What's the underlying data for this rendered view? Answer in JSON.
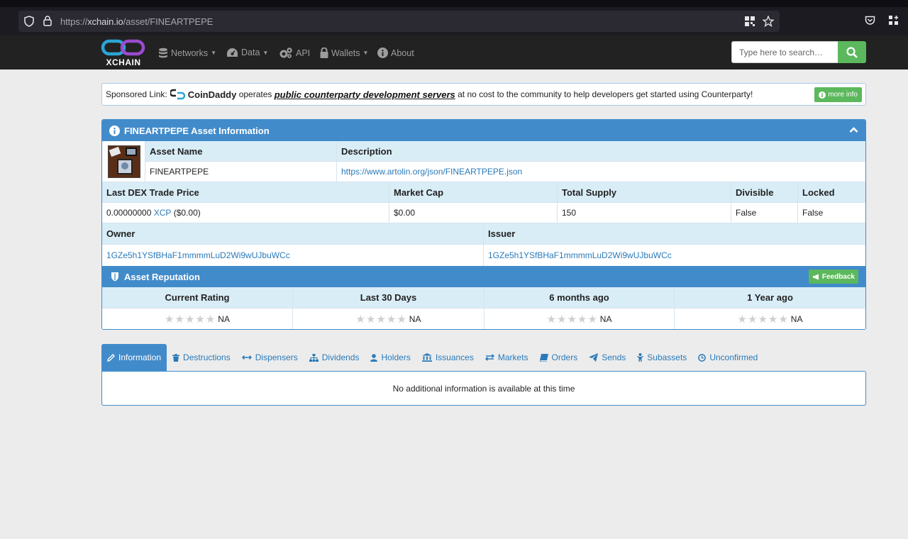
{
  "browser": {
    "url_prefix": "https://",
    "url_host": "xchain.io",
    "url_path": "/asset/FINEARTPEPE"
  },
  "navbar": {
    "logo_text": "XCHAIN",
    "items": [
      {
        "label": "Networks",
        "icon": "database-icon",
        "dropdown": true
      },
      {
        "label": "Data",
        "icon": "dashboard-icon",
        "dropdown": true
      },
      {
        "label": "API",
        "icon": "gears-icon",
        "dropdown": false
      },
      {
        "label": "Wallets",
        "icon": "lock-icon",
        "dropdown": true
      },
      {
        "label": "About",
        "icon": "info-circle-icon",
        "dropdown": false
      }
    ],
    "search_placeholder": "Type here to search…"
  },
  "sponsor": {
    "prefix": "Sponsored Link:",
    "brand": "CoinDaddy",
    "mid": " operates ",
    "link": "public counterparty development servers",
    "suffix": " at no cost to the community to help developers get started using Counterparty!",
    "button": "more info"
  },
  "asset_panel": {
    "title": "FINEARTPEPE Asset Information",
    "asset_name_label": "Asset Name",
    "asset_name": "FINEARTPEPE",
    "description_label": "Description",
    "description": "https://www.artolin.org/json/FINEARTPEPE.json",
    "last_trade_label": "Last DEX Trade Price",
    "last_trade_amount": "0.00000000 ",
    "last_trade_currency": "XCP",
    "last_trade_usd": " ($0.00)",
    "market_cap_label": "Market Cap",
    "market_cap": "$0.00",
    "total_supply_label": "Total Supply",
    "total_supply": "150",
    "divisible_label": "Divisible",
    "divisible": "False",
    "locked_label": "Locked",
    "locked": "False",
    "owner_label": "Owner",
    "owner": "1GZe5h1YSfBHaF1mmmmLuD2Wi9wUJbuWCc",
    "issuer_label": "Issuer",
    "issuer": "1GZe5h1YSfBHaF1mmmmLuD2Wi9wUJbuWCc"
  },
  "reputation": {
    "title": "Asset Reputation",
    "feedback_button": "Feedback",
    "columns": [
      {
        "label": "Current Rating",
        "value": "NA"
      },
      {
        "label": "Last 30 Days",
        "value": "NA"
      },
      {
        "label": "6 months ago",
        "value": "NA"
      },
      {
        "label": "1 Year ago",
        "value": "NA"
      }
    ]
  },
  "tabs": [
    {
      "label": "Information",
      "icon": "pencil-icon",
      "active": true
    },
    {
      "label": "Destructions",
      "icon": "trash-icon",
      "active": false
    },
    {
      "label": "Dispensers",
      "icon": "arrows-h-icon",
      "active": false
    },
    {
      "label": "Dividends",
      "icon": "sitemap-icon",
      "active": false
    },
    {
      "label": "Holders",
      "icon": "user-icon",
      "active": false
    },
    {
      "label": "Issuances",
      "icon": "bank-icon",
      "active": false
    },
    {
      "label": "Markets",
      "icon": "exchange-icon",
      "active": false
    },
    {
      "label": "Orders",
      "icon": "book-icon",
      "active": false
    },
    {
      "label": "Sends",
      "icon": "send-icon",
      "active": false
    },
    {
      "label": "Subassets",
      "icon": "child-icon",
      "active": false
    },
    {
      "label": "Unconfirmed",
      "icon": "clock-icon",
      "active": false
    }
  ],
  "tab_content": "No additional information is available at this time"
}
